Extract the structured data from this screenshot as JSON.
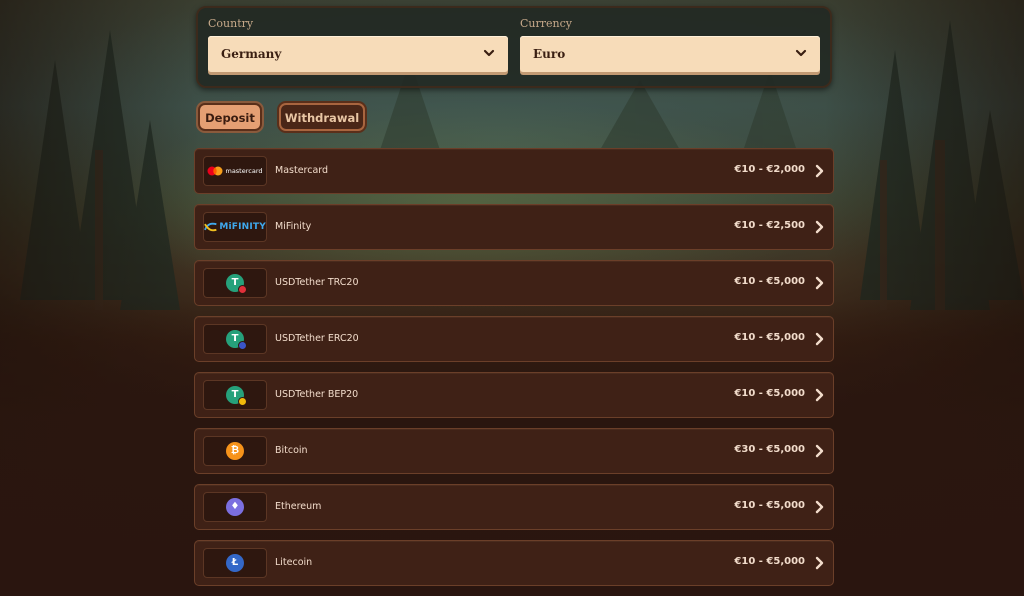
{
  "filters": {
    "country_label": "Country",
    "country_value": "Germany",
    "currency_label": "Currency",
    "currency_value": "Euro"
  },
  "tabs": {
    "deposit": "Deposit",
    "withdrawal": "Withdrawal",
    "active": "deposit"
  },
  "methods": [
    {
      "name": "Mastercard",
      "limit": "€10 - €2,000",
      "logo_text": "mastercard",
      "icon": "mastercard-logo"
    },
    {
      "name": "MiFinity",
      "limit": "€10 - €2,500",
      "logo_text": "MiFINITY",
      "icon": "mifinity-logo"
    },
    {
      "name": "USDTether TRC20",
      "limit": "€10 - €5,000",
      "coin_symbol": "T",
      "icon": "tether-trc20-icon"
    },
    {
      "name": "USDTether ERC20",
      "limit": "€10 - €5,000",
      "coin_symbol": "T",
      "icon": "tether-erc20-icon"
    },
    {
      "name": "USDTether BEP20",
      "limit": "€10 - €5,000",
      "coin_symbol": "T",
      "icon": "tether-bep20-icon"
    },
    {
      "name": "Bitcoin",
      "limit": "€30 - €5,000",
      "coin_symbol": "₿",
      "icon": "bitcoin-icon"
    },
    {
      "name": "Ethereum",
      "limit": "€10 - €5,000",
      "coin_symbol": "♦",
      "icon": "ethereum-icon"
    },
    {
      "name": "Litecoin",
      "limit": "€10 - €5,000",
      "coin_symbol": "Ł",
      "icon": "litecoin-icon"
    }
  ],
  "colors": {
    "row_background": "#3f2116",
    "select_background": "#f7dcb9",
    "tab_active": "#e59f73",
    "tether_green": "#26a17b",
    "bitcoin_orange": "#f7931a",
    "ethereum_purple": "#7b6fe0",
    "litecoin_blue": "#3468c8"
  }
}
